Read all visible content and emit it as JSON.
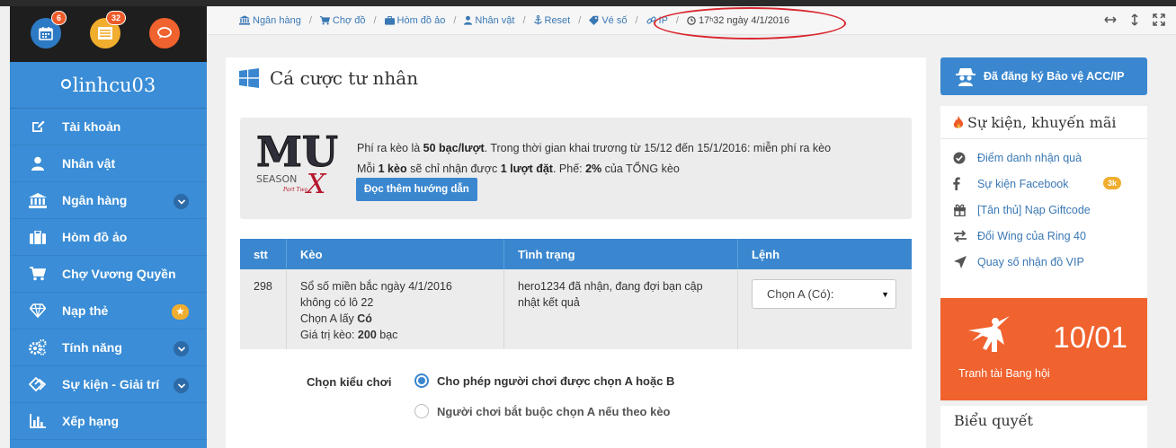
{
  "sidebar": {
    "badges": {
      "calendar": "6",
      "list": "32"
    },
    "username": "linhcu03",
    "items": [
      {
        "label": "Tài khoản",
        "icon": "edit-icon"
      },
      {
        "label": "Nhân vật",
        "icon": "user-icon"
      },
      {
        "label": "Ngân hàng",
        "icon": "bank-icon",
        "has_chevron": true
      },
      {
        "label": "Hòm đồ ảo",
        "icon": "briefcase-icon"
      },
      {
        "label": "Chợ Vương Quyền",
        "icon": "cart-icon"
      },
      {
        "label": "Nạp thẻ",
        "icon": "diamond-icon",
        "badge": "star"
      },
      {
        "label": "Tính năng",
        "icon": "gears-icon",
        "has_chevron": true
      },
      {
        "label": "Sự kiện - Giải trí",
        "icon": "tags-icon",
        "has_chevron": true
      },
      {
        "label": "Xếp hạng",
        "icon": "bar-chart-icon"
      }
    ]
  },
  "breadcrumb": [
    {
      "label": "Ngân hàng",
      "icon": "bank-icon"
    },
    {
      "label": "Chợ đồ",
      "icon": "cart-icon"
    },
    {
      "label": "Hòm đồ ảo",
      "icon": "briefcase-icon"
    },
    {
      "label": "Nhân vật",
      "icon": "user-icon"
    },
    {
      "label": "Reset",
      "icon": "anchor-icon"
    },
    {
      "label": "Vé số",
      "icon": "ticket-icon"
    },
    {
      "label": "IP",
      "icon": "link-icon"
    }
  ],
  "clock": {
    "hour": "17",
    "suffix": "h",
    "rest": "32 ngày 4/1/2016"
  },
  "page": {
    "title": "Cá cược tư nhân",
    "logo_text": {
      "brand": "MU",
      "sub": "SEASON",
      "sub2": "X",
      "tag": "Part Two"
    },
    "info": {
      "line1_a": "Phí ra kèo là ",
      "line1_b": "50 bạc/lượt",
      "line1_c": ". Trong thời gian khai trương từ 15/12 đến 15/1/2016: miễn phí ra kèo",
      "line2_a": "Mỗi ",
      "line2_b": "1 kèo",
      "line2_c": " sẽ chỉ nhận được ",
      "line2_d": "1 lượt đặt",
      "line2_e": ". Phế: ",
      "line2_f": "2%",
      "line2_g": " của TỔNG kèo"
    },
    "guide_button": "Đọc thêm hướng dẫn"
  },
  "table": {
    "headers": [
      "stt",
      "Kèo",
      "Tình trạng",
      "Lệnh"
    ],
    "row": {
      "stt": "298",
      "keo_line1": "Sổ số miền bắc ngày 4/1/2016",
      "keo_line2": "không có lô 22",
      "keo_line3_a": "Chọn A lấy ",
      "keo_line3_b": "Có",
      "keo_line4_a": "Giá trị kèo: ",
      "keo_line4_b": "200",
      "keo_line4_c": " bạc",
      "status": "hero1234 đã nhận, đang đợi bạn cập nhật kết quả",
      "select_value": "Chọn A (Có):"
    }
  },
  "play_mode": {
    "label": "Chọn kiểu chơi",
    "options": [
      {
        "label": "Cho phép người chơi được chọn A hoặc B",
        "selected": true
      },
      {
        "label": "Người chơi bắt buộc chọn A nếu theo kèo",
        "selected": false
      }
    ]
  },
  "right": {
    "protect_button": "Đã đăng ký Bảo vệ ACC/IP",
    "events_title": "Sự kiện, khuyến mãi",
    "events": [
      {
        "label": "Điểm danh nhận quà",
        "icon": "check-circle-icon"
      },
      {
        "label": "Sự kiện Facebook",
        "icon": "facebook-icon",
        "badge": "3k"
      },
      {
        "label": "[Tân thủ] Nạp Giftcode",
        "icon": "gift-icon"
      },
      {
        "label": "Đổi Wing của Ring 40",
        "icon": "exchange-icon"
      },
      {
        "label": "Quay số nhận đồ VIP",
        "icon": "send-icon"
      }
    ],
    "promo": {
      "date": "10/01",
      "label": "Tranh tài Bang hội"
    },
    "vote_title": "Biểu quyết"
  },
  "colors": {
    "sidebar": "#3a8dd6",
    "primary": "#3a87cf",
    "orange": "#f0622e",
    "annotation": "#d9262e"
  }
}
